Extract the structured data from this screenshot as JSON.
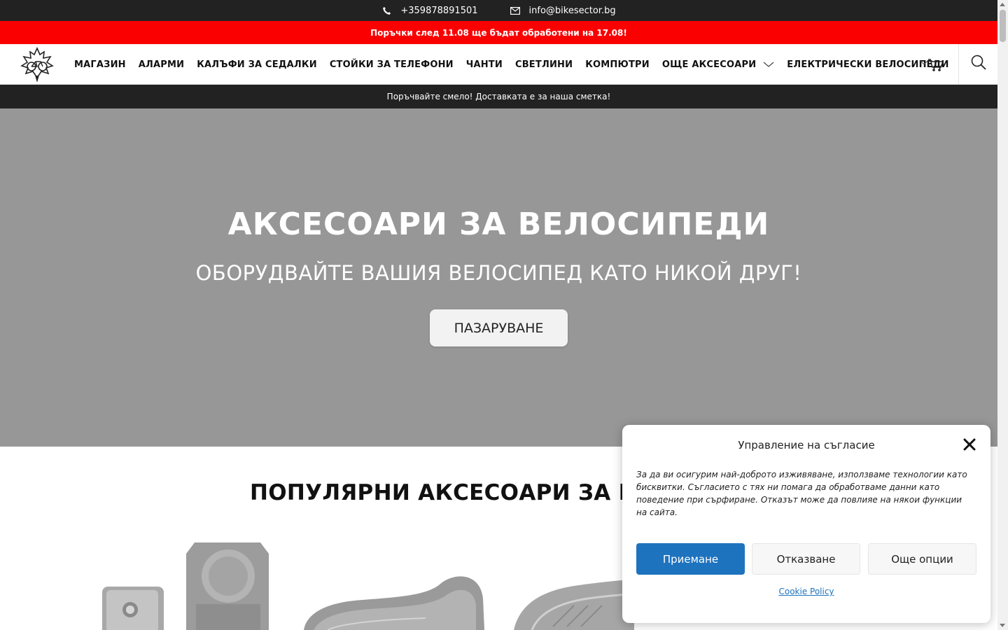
{
  "topbar": {
    "phone": "+359878891501",
    "email": "info@bikesector.bg",
    "phone_icon": "phone-icon",
    "email_icon": "envelope-icon"
  },
  "notice": {
    "text": "Поръчки след 11.08 ще бъдат обработени на 17.08!",
    "bg_color": "#fa0000"
  },
  "nav": {
    "items": [
      "МАГАЗИН",
      "АЛАРМИ",
      "КАЛЪФИ ЗА СЕДАЛКИ",
      "СТОЙКИ ЗА ТЕЛЕФОНИ",
      "ЧАНТИ",
      "СВЕТЛИНИ",
      "КОМПЮТРИ",
      "ОЩЕ АКСЕСОАРИ",
      "ЕЛЕКТРИЧЕСКИ ВЕЛОСИПЕДИ"
    ],
    "icons": [
      "logo-icon",
      "chevron-down-icon",
      "cart-icon",
      "search-icon"
    ]
  },
  "promo": {
    "text": "Поръчвайте смело! Доставката е за наша сметка!"
  },
  "hero": {
    "title": "АКСЕСОАРИ ЗА ВЕЛОСИПЕДИ",
    "subtitle": "ОБОРУДВАЙТЕ ВАШИЯ ВЕЛОСИПЕД КАТО НИКОЙ ДРУГ!",
    "button": "ПАЗАРУВАНЕ",
    "bg_color": "#979797"
  },
  "section": {
    "title": "ПОПУЛЯРНИ АКСЕСОАРИ ЗА ВЕЛ"
  },
  "consent": {
    "title": "Управление на съгласие",
    "text": "За да ви осигурим най-доброто изживяване, използваме технологии като бисквитки. Съгласието с тях ни помага да обработваме данни като поведение при сърфиране. Отказът може да повлияе на някои функции на сайта.",
    "accept": "Приемане",
    "deny": "Отказване",
    "more": "Още опции",
    "policy": "Cookie Policy",
    "accent_color": "#1e73be"
  }
}
